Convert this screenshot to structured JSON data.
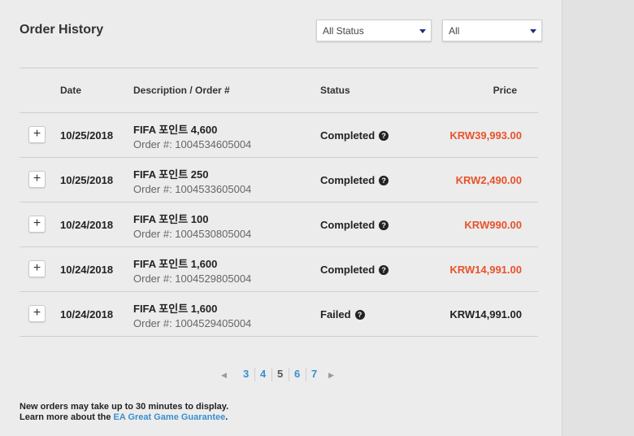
{
  "header": {
    "title": "Order History",
    "status_filter": "All Status",
    "period_filter": "All"
  },
  "table": {
    "columns": [
      "Date",
      "Description / Order #",
      "Status",
      "Price"
    ],
    "rows": [
      {
        "date": "10/25/2018",
        "description": "FIFA 포인트 4,600",
        "order": "Order #: 1004534605004",
        "status": "Completed",
        "price": "KRW39,993.00"
      },
      {
        "date": "10/25/2018",
        "description": "FIFA 포인트 250",
        "order": "Order #: 1004533605004",
        "status": "Completed",
        "price": "KRW2,490.00"
      },
      {
        "date": "10/24/2018",
        "description": "FIFA 포인트 100",
        "order": "Order #: 1004530805004",
        "status": "Completed",
        "price": "KRW990.00"
      },
      {
        "date": "10/24/2018",
        "description": "FIFA 포인트 1,600",
        "order": "Order #: 1004529805004",
        "status": "Completed",
        "price": "KRW14,991.00"
      },
      {
        "date": "10/24/2018",
        "description": "FIFA 포인트 1,600",
        "order": "Order #: 1004529405004",
        "status": "Failed",
        "price": "KRW14,991.00"
      }
    ]
  },
  "icons": {
    "expand": "+",
    "help": "?",
    "prev": "◀",
    "next": "▶"
  },
  "pagination": {
    "pages": [
      "3",
      "4",
      "5",
      "6",
      "7"
    ],
    "current": "5"
  },
  "footer": {
    "line1": "New orders may take up to 30 minutes to display.",
    "line2_prefix": "Learn more about the ",
    "link": "EA Great Game Guarantee",
    "line2_suffix": "."
  },
  "colors": {
    "price_accent": "#e8532b",
    "link": "#3a8fce",
    "select_arrow": "#1f2f7a"
  }
}
